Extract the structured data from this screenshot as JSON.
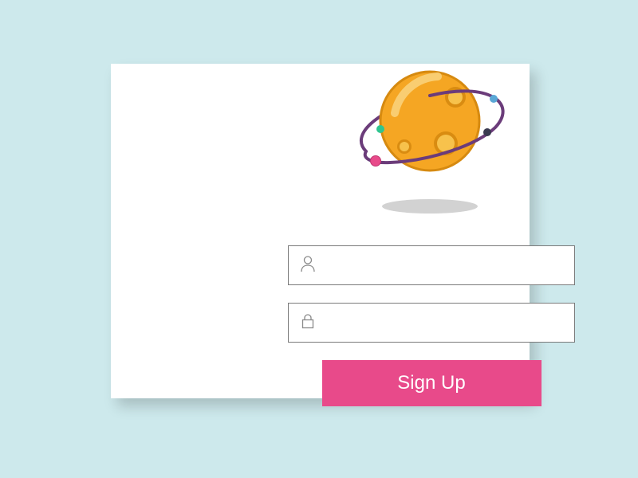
{
  "form": {
    "username": {
      "value": "",
      "placeholder": ""
    },
    "password": {
      "value": "",
      "placeholder": ""
    },
    "submit_label": "Sign Up"
  },
  "icons": {
    "username": "user-icon",
    "password": "lock-icon",
    "hero": "planet-icon"
  },
  "colors": {
    "page_bg": "#cde9ec",
    "card_bg": "#ffffff",
    "button_bg": "#e84a8a",
    "button_text": "#ffffff",
    "input_border": "#7a7a7a",
    "icon_stroke": "#8a8a8a",
    "planet_body": "#f5a623",
    "planet_highlight": "#f7c24c",
    "ring": "#6b3c7a",
    "dot_pink": "#e84a8a",
    "dot_green": "#2fc58f",
    "dot_blue": "#5aa7d6",
    "dot_dark": "#3a3a50",
    "shadow_ellipse": "#d2d2d2"
  }
}
